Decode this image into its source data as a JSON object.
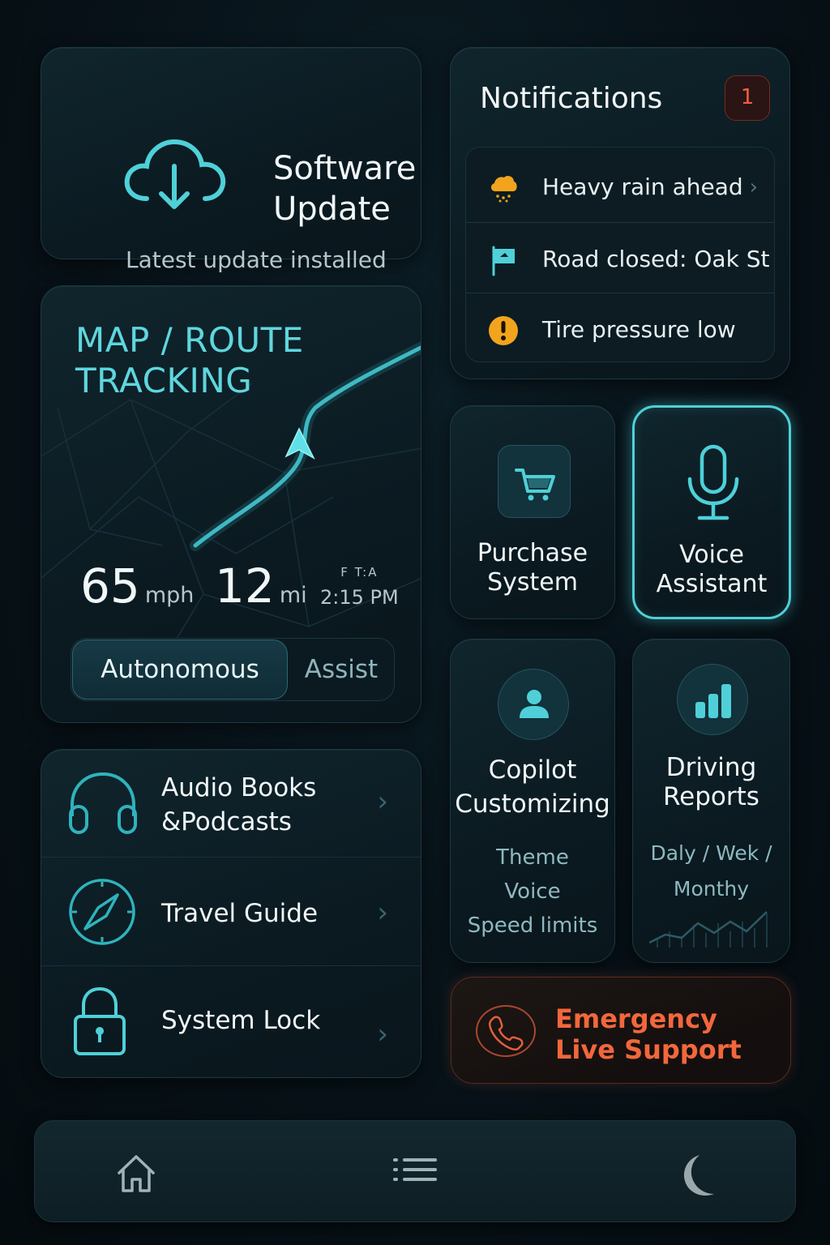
{
  "software_update": {
    "title_line1": "Software",
    "title_line2": "Update",
    "status": "Latest update installed"
  },
  "notifications": {
    "title": "Notifications",
    "count": "1",
    "items": [
      {
        "icon": "rain-cloud-icon",
        "text": "Heavy rain ahead"
      },
      {
        "icon": "flag-icon",
        "text": "Road closed: Oak St"
      },
      {
        "icon": "warning-icon",
        "text": "Tire pressure low"
      }
    ]
  },
  "map": {
    "title_line1": "MAP / ROUTE",
    "title_line2": "TRACKING",
    "speed_value": "65",
    "speed_unit": "mph",
    "distance_value": "12",
    "distance_unit": "mi",
    "eta_label": "F T:A",
    "eta_value": "2:15 PM",
    "mode_active": "Autonomous",
    "mode_other": "Assist"
  },
  "tiles": {
    "purchase_line1": "Purchase",
    "purchase_line2": "System",
    "voice_line1": "Voice",
    "voice_line2": "Assistant",
    "copilot_line1": "Copilot",
    "copilot_line2": "Customizing",
    "copilot_options": [
      "Theme",
      "Voice",
      "Speed limits"
    ],
    "reports_line1": "Driving",
    "reports_line2": "Reports",
    "reports_options_line1": "Daly / Wek /",
    "reports_options_line2": "Monthy"
  },
  "emergency": {
    "line1": "Emergency",
    "line2": "Live Support",
    "color": "#f2673c"
  },
  "list": {
    "audio_line1": "Audio Books",
    "audio_line2": "&Podcasts",
    "travel": "Travel Guide",
    "lock": "System Lock"
  },
  "bottom_nav": [
    "home-icon",
    "menu-icon",
    "moon-icon"
  ],
  "colors": {
    "accent": "#4fd0d8",
    "background": "#071117",
    "warning": "#f2a41c",
    "alert": "#f06040"
  }
}
